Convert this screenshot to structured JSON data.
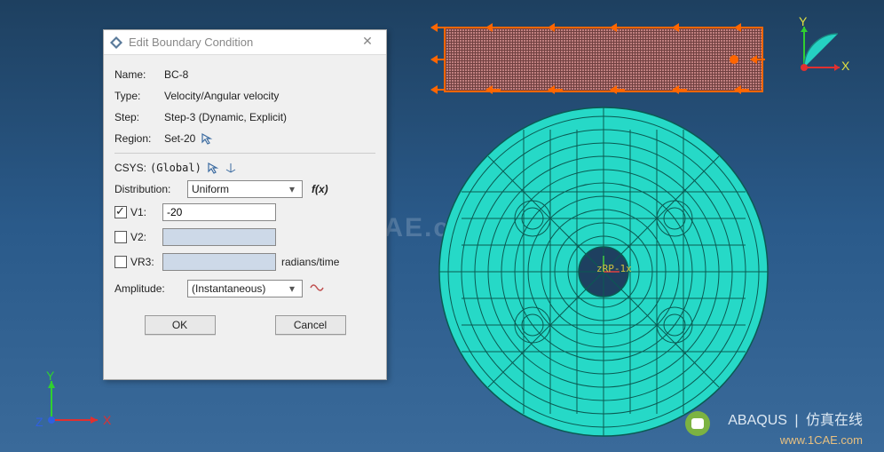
{
  "dialog": {
    "title": "Edit Boundary Condition",
    "name_label": "Name:",
    "name_value": "BC-8",
    "type_label": "Type:",
    "type_value": "Velocity/Angular velocity",
    "step_label": "Step:",
    "step_value": "Step-3 (Dynamic, Explicit)",
    "region_label": "Region:",
    "region_value": "Set-20",
    "csys_label": "CSYS:",
    "csys_value": "(Global)",
    "distribution_label": "Distribution:",
    "distribution_value": "Uniform",
    "fx_label": "f(x)",
    "v1_label": "V1:",
    "v1_value": "-20",
    "v1_checked": true,
    "v2_label": "V2:",
    "v2_value": "",
    "v2_checked": false,
    "vr3_label": "VR3:",
    "vr3_value": "",
    "vr3_checked": false,
    "vr3_unit": "radians/time",
    "amplitude_label": "Amplitude:",
    "amplitude_value": "(Instantaneous)",
    "ok_label": "OK",
    "cancel_label": "Cancel"
  },
  "viewport": {
    "rp_label": "zRP-1x",
    "triad_x": "X",
    "triad_y": "Y",
    "triad_z": "Z"
  },
  "watermark": {
    "brand_left": "ABAQUS",
    "brand_right": "仿真在线",
    "url": "www.1CAE.com",
    "center": "1CAE.com"
  },
  "colors": {
    "bc_arrow": "#ff6600",
    "mesh_cyan": "#26d9c7",
    "axis_x": "#e03030",
    "axis_y": "#30d030",
    "axis_z": "#3060e0"
  }
}
